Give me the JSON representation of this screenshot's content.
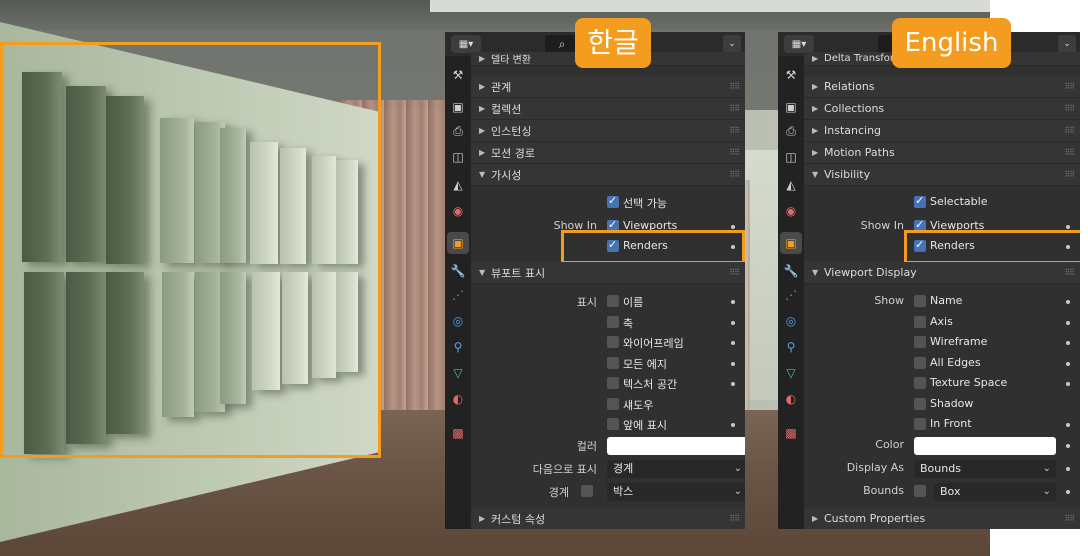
{
  "colors": {
    "accent": "#f39c1f",
    "checkbox_on": "#4772b3",
    "panel_bg": "#303030"
  },
  "tags": {
    "ko": "한글",
    "en": "English"
  },
  "icons": {
    "editor_type": "properties-editor-icon",
    "search": "search-icon",
    "dropdown": "chevron-down-icon",
    "tabs": [
      "tool-icon",
      "render-icon",
      "output-icon",
      "view-layer-icon",
      "scene-icon",
      "world-icon",
      "object-icon",
      "modifier-icon",
      "particles-icon",
      "physics-icon",
      "constraints-icon",
      "object-data-icon",
      "material-icon",
      "texture-icon"
    ]
  },
  "ko": {
    "cut_header": "델타 변환",
    "sections": [
      "관계",
      "컬렉션",
      "인스턴싱",
      "모션 경로",
      "가시성"
    ],
    "visibility": {
      "selectable": "선택 가능",
      "show_in": "Show In",
      "viewports": "Viewports",
      "renders": "Renders"
    },
    "viewport_display": {
      "header": "뷰포트 표시",
      "show": "표시",
      "options": [
        "이름",
        "축",
        "와이어프레임",
        "모든 에지",
        "텍스처 공간",
        "섀도우",
        "앞에 표시"
      ],
      "color": "컬러",
      "display_as": "다음으로 표시",
      "display_as_value": "경계",
      "bounds": "경계",
      "bounds_value": "박스"
    },
    "custom_props": "커스텀 속성"
  },
  "en": {
    "cut_header": "Delta Transform",
    "sections": [
      "Relations",
      "Collections",
      "Instancing",
      "Motion Paths",
      "Visibility"
    ],
    "visibility": {
      "selectable": "Selectable",
      "show_in": "Show In",
      "viewports": "Viewports",
      "renders": "Renders"
    },
    "viewport_display": {
      "header": "Viewport Display",
      "show": "Show",
      "options": [
        "Name",
        "Axis",
        "Wireframe",
        "All Edges",
        "Texture Space",
        "Shadow",
        "In Front"
      ],
      "color": "Color",
      "display_as": "Display As",
      "display_as_value": "Bounds",
      "bounds": "Bounds",
      "bounds_value": "Box"
    },
    "custom_props": "Custom Properties"
  }
}
